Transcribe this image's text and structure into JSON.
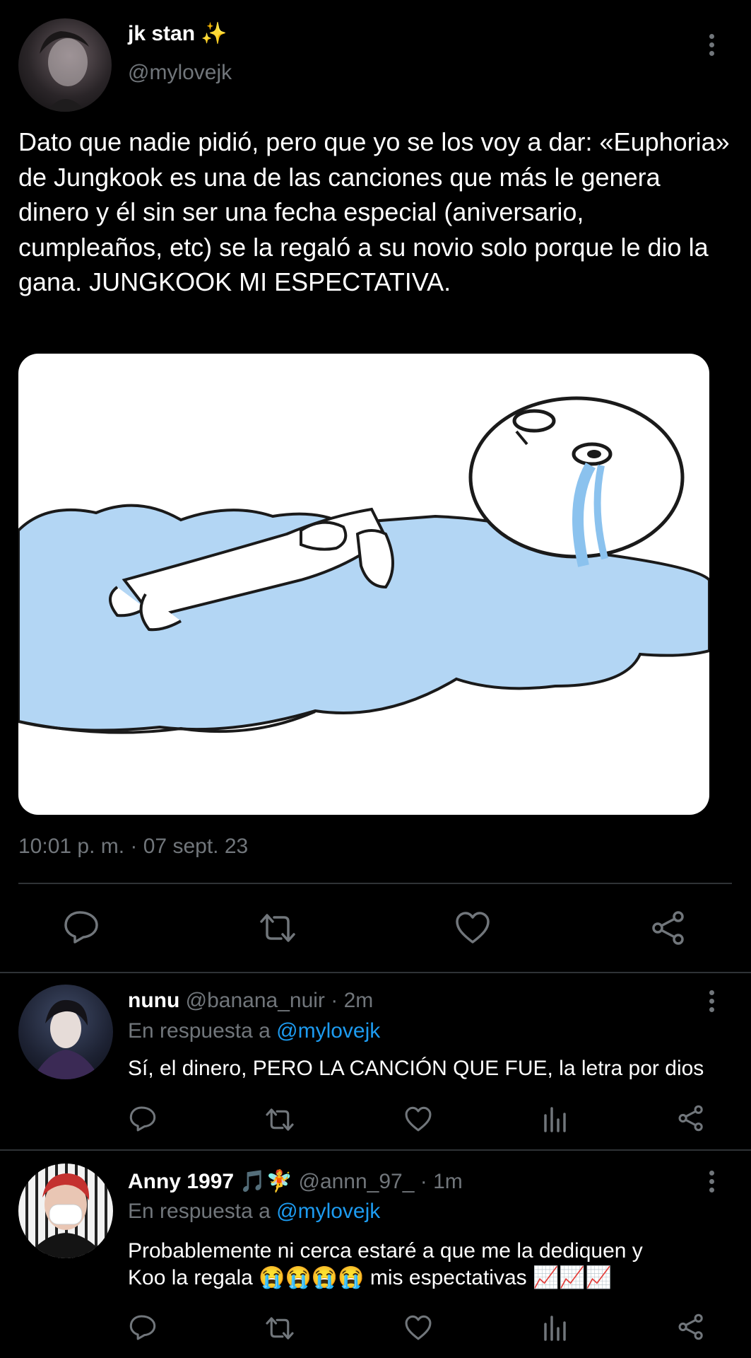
{
  "main_tweet": {
    "author": {
      "name": "jk stan",
      "name_emoji": "✨",
      "handle": "@mylovejk"
    },
    "text": "Dato que nadie pidió, pero que yo se los voy a dar: «Euphoria» de Jungkook es una de las canciones que más le genera dinero y él sin ser una fecha especial (aniversario, cumpleaños, etc) se la regaló a su novio solo porque le dio la gana. JUNGKOOK MI ESPECTATIVA.",
    "timestamp": "10:01 p. m. · 07 sept. 23",
    "media_icon": "crying-figure-in-puddle-meme",
    "actions": [
      "reply-icon",
      "retweet-icon",
      "like-icon",
      "share-icon"
    ]
  },
  "replies": [
    {
      "name": "nunu",
      "handle": "@banana_nuir",
      "time": "· 2m",
      "reply_prefix": "En respuesta a",
      "reply_to": "@mylovejk",
      "text": "Sí, el dinero, PERO LA CANCIÓN QUE FUE, la letra por dios"
    },
    {
      "name": "Anny 1997",
      "name_emoji": "🎵🧚",
      "handle": "@annn_97_",
      "time": "· 1m",
      "reply_prefix": "En respuesta a",
      "reply_to": "@mylovejk",
      "text_line1": "Probablemente ni cerca estaré a que me la dediquen y",
      "text_line2_a": "Koo la regala",
      "text_line2_b": "mis espectativas",
      "emoji_crying": "😭😭😭😭",
      "emoji_chart": "📈📈📈"
    }
  ],
  "colors": {
    "background": "#000000",
    "text": "#e7e9ea",
    "muted": "#71767b",
    "link": "#1d9bf0",
    "divider": "#2f3336"
  }
}
